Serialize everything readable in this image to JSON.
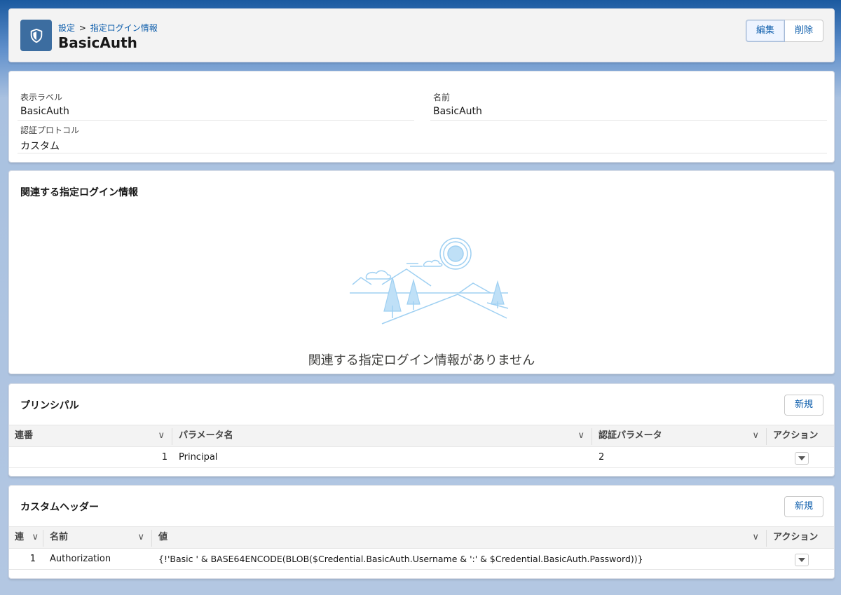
{
  "header": {
    "breadcrumb": [
      "設定",
      "指定ログイン情報"
    ],
    "breadcrumb_sep": ">",
    "title": "BasicAuth",
    "edit_label": "編集",
    "delete_label": "削除",
    "icon": "shield-icon"
  },
  "details": {
    "display_label": {
      "label": "表示ラベル",
      "value": "BasicAuth"
    },
    "name": {
      "label": "名前",
      "value": "BasicAuth"
    },
    "auth_protocol": {
      "label": "認証プロトコル",
      "value": "カスタム"
    }
  },
  "related": {
    "title": "関連する指定ログイン情報",
    "empty_message": "関連する指定ログイン情報がありません"
  },
  "principals": {
    "title": "プリンシパル",
    "new_label": "新規",
    "columns": [
      "連番",
      "パラメータ名",
      "認証パラメータ",
      "アクション"
    ],
    "rows": [
      {
        "seq": "1",
        "param_name": "Principal",
        "auth_param": "2"
      }
    ]
  },
  "custom_headers": {
    "title": "カスタムヘッダー",
    "new_label": "新規",
    "columns": [
      "連",
      "名前",
      "値",
      "アクション"
    ],
    "rows": [
      {
        "seq": "1",
        "name": "Authorization",
        "value": "{!'Basic ' & BASE64ENCODE(BLOB($Credential.BasicAuth.Username & ':' & $Credential.BasicAuth.Password))}"
      }
    ]
  },
  "colors": {
    "brand": "#0b5cab",
    "icon_bg": "#3c6da0"
  }
}
